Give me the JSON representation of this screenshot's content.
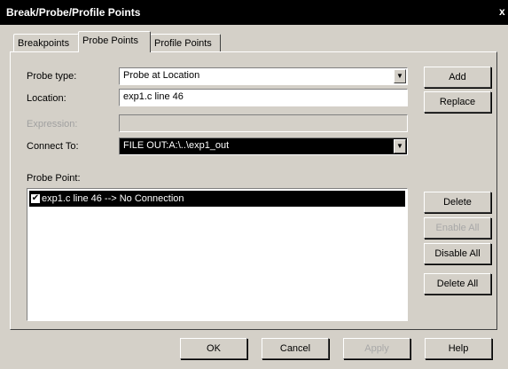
{
  "window": {
    "title": "Break/Probe/Profile Points",
    "close_label": "x"
  },
  "tabs": [
    {
      "label": "Breakpoints"
    },
    {
      "label": "Probe Points",
      "active": true
    },
    {
      "label": "Profile Points"
    }
  ],
  "form": {
    "probe_type_label": "Probe type:",
    "probe_type_value": "Probe at Location",
    "location_label": "Location:",
    "location_value": "exp1.c line 46",
    "expression_label": "Expression:",
    "expression_value": "",
    "connect_to_label": "Connect To:",
    "connect_to_value": "FILE OUT:A:\\..\\exp1_out",
    "probe_point_label": "Probe Point:"
  },
  "probe_points": [
    {
      "label": "exp1.c line 46 --> No Connection",
      "checked": true
    }
  ],
  "side_buttons": {
    "add": "Add",
    "replace": "Replace",
    "delete": "Delete",
    "enable_all": "Enable All",
    "disable_all": "Disable All",
    "delete_all": "Delete All"
  },
  "bottom_buttons": {
    "ok": "OK",
    "cancel": "Cancel",
    "apply": "Apply",
    "help": "Help"
  },
  "icons": {
    "dropdown": "chevron-down-icon",
    "close": "close-icon",
    "check": "checkbox-checked-icon"
  }
}
